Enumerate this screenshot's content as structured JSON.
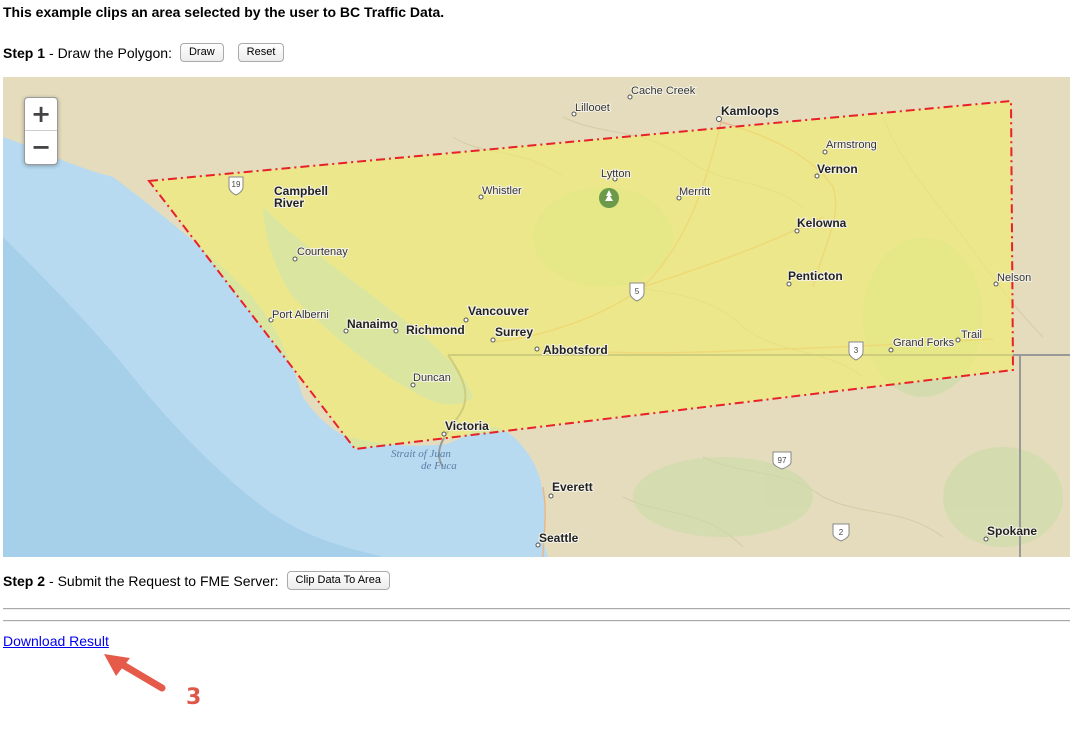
{
  "intro": "This example clips an area selected by the user to BC Traffic Data.",
  "step1": {
    "label": "Step 1",
    "text": "- Draw the Polygon:",
    "draw_button": "Draw",
    "reset_button": "Reset"
  },
  "step2": {
    "label": "Step 2",
    "text": "- Submit the Request to FME Server:",
    "clip_button": "Clip Data To Area"
  },
  "zoom": {
    "in": "+",
    "out": "−"
  },
  "download_link": "Download Result",
  "annotation_number": "3",
  "map": {
    "cities": {
      "cache_creek": "Cache Creek",
      "lillooet": "Lillooet",
      "kamloops": "Kamloops",
      "armstrong": "Armstrong",
      "vernon": "Vernon",
      "campbell_river": "Campbell",
      "campbell_river_2": "River",
      "whistler": "Whistler",
      "lytton": "Lytton",
      "merritt": "Merritt",
      "kelowna": "Kelowna",
      "courtenay": "Courtenay",
      "penticton": "Penticton",
      "nelson": "Nelson",
      "port_alberni": "Port Alberni",
      "nanaimo": "Nanaimo",
      "richmond": "Richmond",
      "vancouver": "Vancouver",
      "surrey": "Surrey",
      "abbotsford": "Abbotsford",
      "trail": "Trail",
      "grand_forks": "Grand Forks",
      "duncan": "Duncan",
      "victoria": "Victoria",
      "everett": "Everett",
      "seattle": "Seattle",
      "spokane": "Spokane"
    },
    "water": {
      "strait_1": "Strait of Juan",
      "strait_2": "de Fuca"
    },
    "shields": {
      "hwy19": "19",
      "hwy5": "5",
      "hwy3": "3",
      "us97": "97",
      "us2": "2"
    },
    "colors": {
      "polygon_fill": "#f2ef6a",
      "polygon_stroke": "#e8202a",
      "ocean": "#b9dbf0",
      "land": "#e6dfc0"
    }
  }
}
